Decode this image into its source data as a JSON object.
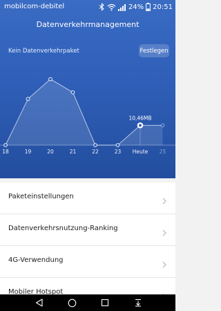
{
  "status_bar": {
    "carrier": "mobilcom-debitel",
    "battery_percent": "24%",
    "time": "20:51",
    "icons": [
      "bluetooth-icon",
      "wifi-icon",
      "signal-icon",
      "battery-icon"
    ]
  },
  "header": {
    "title": "Datenverkehrmanagement",
    "package_status": "Kein Datenverkehrpaket",
    "set_button": "Festlegen"
  },
  "colors": {
    "hero_top": "#3a6cc4",
    "hero_bottom": "#234e9f",
    "list_bg": "#ffffff",
    "page_bg": "#f2f2f2",
    "nav_bg": "#000000"
  },
  "chart_data": {
    "type": "area",
    "categories": [
      "18",
      "19",
      "20",
      "21",
      "22",
      "23",
      "Heute",
      "25"
    ],
    "series": [
      {
        "values": [
          0,
          0.7,
          1.0,
          0.8,
          0,
          0,
          0.3,
          0.3
        ],
        "highlighted_index": 6,
        "highlighted_label": "10,46MB"
      }
    ],
    "ylim": [
      0,
      1.1
    ],
    "grid": false
  },
  "list": {
    "items": [
      {
        "label": "Paketeinstellungen"
      },
      {
        "label": "Datenverkehrsnutzung-Ranking"
      },
      {
        "label": "4G-Verwendung"
      },
      {
        "label": "Mobiler Hotspot"
      }
    ]
  },
  "navbar": {
    "icons": [
      "back-icon",
      "home-icon",
      "recents-icon",
      "notifications-icon"
    ]
  }
}
